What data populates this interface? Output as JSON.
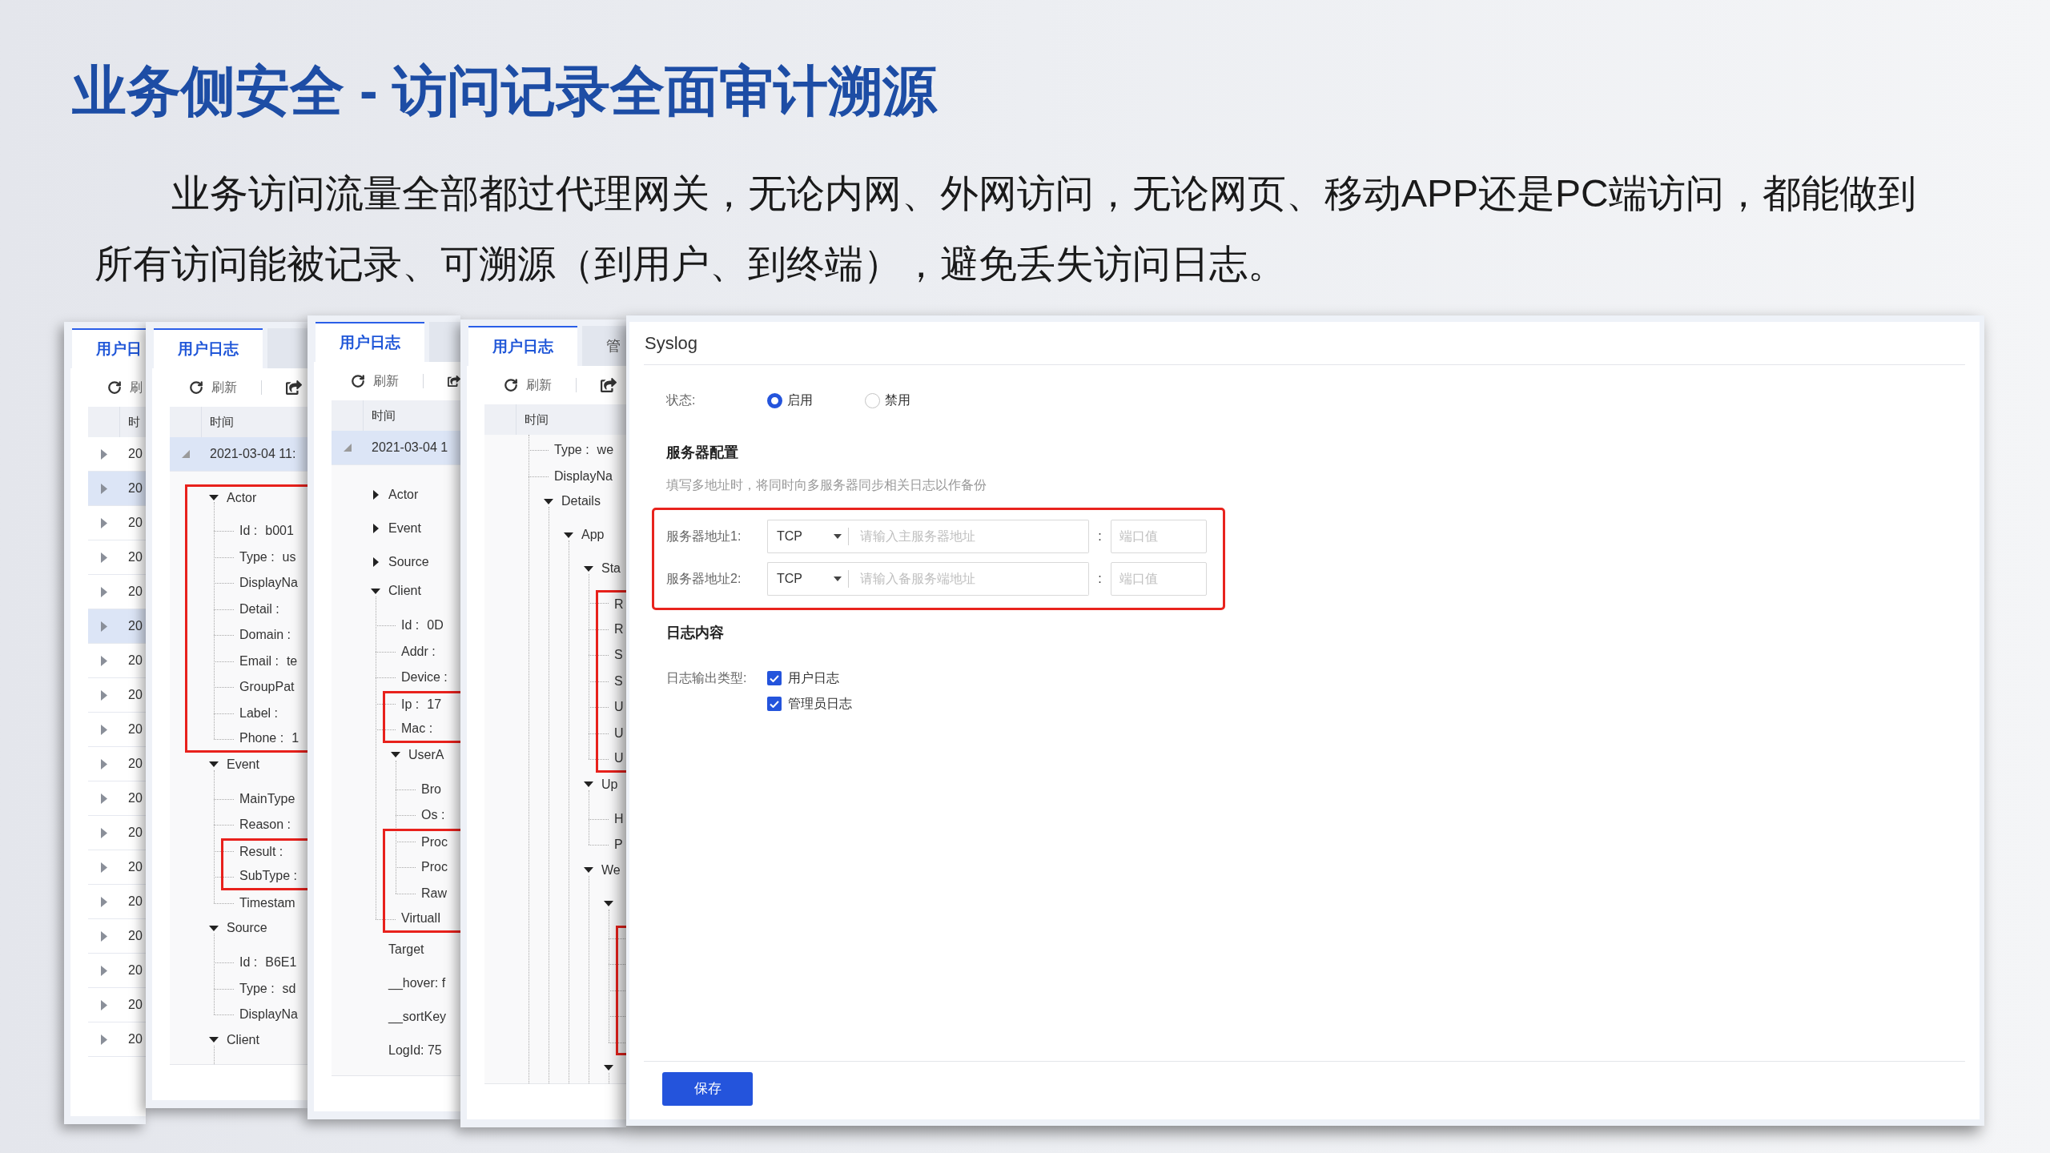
{
  "slide": {
    "title": "业务侧安全 - 访问记录全面审计溯源",
    "body": "业务访问流量全部都过代理网关，无论内网、外网访问，无论网页、移动APP还是PC端访问，都能做到所有访问能被记录、可溯源（到用户、到终端），避免丢失访问日志。"
  },
  "log_windows": [
    {
      "tabs": [
        {
          "label": "用户日",
          "selected": true
        }
      ],
      "toolbar": [
        {
          "kind": "refresh",
          "label": "刷"
        }
      ],
      "columns": [
        "时"
      ],
      "rows": [
        {
          "time": "20",
          "selected": false,
          "expanded": false
        },
        {
          "time": "20",
          "selected": true,
          "expanded": false
        },
        {
          "time": "20",
          "selected": false,
          "expanded": false
        },
        {
          "time": "20",
          "selected": false,
          "expanded": false
        },
        {
          "time": "20",
          "selected": false,
          "expanded": false
        },
        {
          "time": "20",
          "selected": true,
          "expanded": false
        },
        {
          "time": "20",
          "selected": false,
          "expanded": false
        },
        {
          "time": "20",
          "selected": false,
          "expanded": false
        },
        {
          "time": "20",
          "selected": false,
          "expanded": false
        },
        {
          "time": "20",
          "selected": false,
          "expanded": false
        },
        {
          "time": "20",
          "selected": false,
          "expanded": false
        },
        {
          "time": "20",
          "selected": false,
          "expanded": false
        },
        {
          "time": "20",
          "selected": false,
          "expanded": false
        },
        {
          "time": "20",
          "selected": false,
          "expanded": false
        },
        {
          "time": "20",
          "selected": false,
          "expanded": false
        },
        {
          "time": "20",
          "selected": false,
          "expanded": false
        },
        {
          "time": "20",
          "selected": false,
          "expanded": false
        },
        {
          "time": "20",
          "selected": false,
          "expanded": false
        }
      ]
    },
    {
      "tabs": [
        {
          "label": "用户日志",
          "selected": true
        },
        {
          "selected": false
        }
      ],
      "toolbar": [
        {
          "kind": "refresh",
          "label": "刷新"
        },
        {
          "kind": "export"
        }
      ],
      "columns": [
        "时间"
      ],
      "rows": [
        {
          "time": "2021-03-04 11:",
          "selected": true,
          "expanded": true
        }
      ],
      "detail_tree": {
        "scrolled": false,
        "nodes": [
          {
            "kind": "group",
            "label": "Actor",
            "expanded": true,
            "highlighted": true,
            "children": [
              {
                "kind": "field",
                "label": "Id :",
                "value": "b001",
                "highlighted": true
              },
              {
                "kind": "field",
                "label": "Type :",
                "value": "us",
                "highlighted": true
              },
              {
                "kind": "field",
                "label": "DisplayNa",
                "highlighted": true
              },
              {
                "kind": "field",
                "label": "Detail :",
                "highlighted": true
              },
              {
                "kind": "field",
                "label": "Domain :",
                "highlighted": true
              },
              {
                "kind": "field",
                "label": "Email :",
                "value": "te",
                "highlighted": true
              },
              {
                "kind": "field",
                "label": "GroupPat",
                "highlighted": true
              },
              {
                "kind": "field",
                "label": "Label :",
                "highlighted": true
              },
              {
                "kind": "field",
                "label": "Phone :",
                "value": "1",
                "highlighted": true
              }
            ]
          },
          {
            "kind": "group",
            "label": "Event",
            "expanded": true,
            "highlighted": false,
            "children": [
              {
                "kind": "field",
                "label": "MainType",
                "highlighted": false
              },
              {
                "kind": "field",
                "label": "Reason :",
                "highlighted": false
              },
              {
                "kind": "field",
                "label": "Result :",
                "highlighted": true
              },
              {
                "kind": "field",
                "label": "SubType :",
                "highlighted": true
              },
              {
                "kind": "field",
                "label": "Timestam",
                "highlighted": false
              }
            ]
          },
          {
            "kind": "group",
            "label": "Source",
            "expanded": true,
            "highlighted": false,
            "children": [
              {
                "kind": "field",
                "label": "Id :",
                "value": "B6E1",
                "highlighted": false
              },
              {
                "kind": "field",
                "label": "Type :",
                "value": "sd",
                "highlighted": false
              },
              {
                "kind": "field",
                "label": "DisplayNa",
                "highlighted": false
              }
            ]
          },
          {
            "kind": "group",
            "label": "Client",
            "expanded": true,
            "highlighted": false
          }
        ]
      }
    },
    {
      "tabs": [
        {
          "label": "用户日志",
          "selected": true
        },
        {
          "selected": false
        }
      ],
      "toolbar": [
        {
          "kind": "refresh",
          "label": "刷新"
        },
        {
          "kind": "export"
        }
      ],
      "columns": [
        "时间"
      ],
      "rows": [
        {
          "time": "2021-03-04 1",
          "selected": true,
          "expanded": true
        }
      ],
      "detail_tree": {
        "scrolled": false,
        "nodes": [
          {
            "kind": "group",
            "label": "Actor",
            "expanded": false,
            "highlighted": false
          },
          {
            "kind": "group",
            "label": "Event",
            "expanded": false,
            "highlighted": false
          },
          {
            "kind": "group",
            "label": "Source",
            "expanded": false,
            "highlighted": false
          },
          {
            "kind": "group",
            "label": "Client",
            "expanded": true,
            "highlighted": false,
            "children": [
              {
                "kind": "field",
                "label": "Id :",
                "value": "0D",
                "highlighted": false
              },
              {
                "kind": "field",
                "label": "Addr :",
                "highlighted": false
              },
              {
                "kind": "field",
                "label": "Device :",
                "highlighted": false
              },
              {
                "kind": "field",
                "label": "Ip :",
                "value": "17",
                "highlighted": true
              },
              {
                "kind": "field",
                "label": "Mac :",
                "highlighted": true
              },
              {
                "kind": "group",
                "label": "UserA",
                "expanded": true,
                "highlighted": false,
                "children": [
                  {
                    "kind": "field",
                    "label": "Bro",
                    "highlighted": false
                  },
                  {
                    "kind": "field",
                    "label": "Os :",
                    "highlighted": false
                  },
                  {
                    "kind": "field",
                    "label": "Proc",
                    "highlighted": true
                  },
                  {
                    "kind": "field",
                    "label": "Proc",
                    "highlighted": true
                  },
                  {
                    "kind": "field",
                    "label": "Raw",
                    "highlighted": true
                  }
                ]
              },
              {
                "kind": "field",
                "label": "VirtualI",
                "highlighted": true
              }
            ]
          },
          {
            "kind": "field",
            "label": "Target",
            "highlighted": false
          },
          {
            "kind": "field",
            "label": "__hover: f",
            "highlighted": false
          },
          {
            "kind": "field",
            "label": "__sortKey",
            "highlighted": false
          },
          {
            "kind": "field",
            "label": "LogId: 75",
            "highlighted": false
          }
        ]
      }
    },
    {
      "tabs": [
        {
          "label": "用户日志",
          "selected": true
        },
        {
          "label": "管",
          "selected": false
        }
      ],
      "toolbar": [
        {
          "kind": "refresh",
          "label": "刷新"
        },
        {
          "kind": "export"
        }
      ],
      "columns": [
        "时间"
      ],
      "detail_tree": {
        "scrolled": true,
        "nodes": [
          {
            "kind": "field",
            "label": "Type :",
            "value": "we",
            "highlighted": false
          },
          {
            "kind": "field",
            "label": "DisplayNa",
            "highlighted": false
          },
          {
            "kind": "group",
            "label": "Details",
            "expanded": true,
            "highlighted": false,
            "children": [
              {
                "kind": "group",
                "label": "App",
                "expanded": true,
                "highlighted": false,
                "children": [
                  {
                    "kind": "group",
                    "label": "Sta",
                    "expanded": true,
                    "highlighted": false,
                    "children": [
                      {
                        "kind": "field",
                        "label": "R",
                        "highlighted": true
                      },
                      {
                        "kind": "field",
                        "label": "R",
                        "highlighted": true
                      },
                      {
                        "kind": "field",
                        "label": "S",
                        "highlighted": true
                      },
                      {
                        "kind": "field",
                        "label": "S",
                        "highlighted": true
                      },
                      {
                        "kind": "field",
                        "label": "U",
                        "highlighted": true
                      },
                      {
                        "kind": "field",
                        "label": "U",
                        "highlighted": true
                      },
                      {
                        "kind": "field",
                        "label": "U",
                        "highlighted": true
                      }
                    ]
                  },
                  {
                    "kind": "group",
                    "label": "Up",
                    "expanded": true,
                    "highlighted": false,
                    "children": [
                      {
                        "kind": "field",
                        "label": "H",
                        "highlighted": false
                      },
                      {
                        "kind": "field",
                        "label": "P",
                        "highlighted": false
                      }
                    ]
                  },
                  {
                    "kind": "group",
                    "label": "We",
                    "expanded": true,
                    "highlighted": false,
                    "children": [
                      {
                        "kind": "group",
                        "expanded": true,
                        "highlighted": false,
                        "children": [
                          {
                            "kind": "field",
                            "highlighted": true
                          },
                          {
                            "kind": "field",
                            "highlighted": true
                          },
                          {
                            "kind": "field",
                            "highlighted": true
                          },
                          {
                            "kind": "field",
                            "highlighted": true
                          },
                          {
                            "kind": "field",
                            "highlighted": true
                          }
                        ]
                      },
                      {
                        "kind": "group",
                        "expanded": true,
                        "highlighted": false
                      }
                    ]
                  }
                ]
              }
            ]
          }
        ]
      }
    }
  ],
  "syslog": {
    "title": "Syslog",
    "status": {
      "label": "状态:",
      "options": [
        {
          "label": "启用",
          "selected": true
        },
        {
          "label": "禁用",
          "selected": false
        }
      ]
    },
    "server_section": {
      "heading": "服务器配置",
      "hint": "填写多地址时，将同时向多服务器同步相关日志以作备份",
      "highlighted": true,
      "servers": [
        {
          "label": "服务器地址1:",
          "protocol": "TCP",
          "address": {
            "placeholder": "请输入主服务器地址"
          },
          "separator": ":",
          "port": {
            "placeholder": "端口值"
          }
        },
        {
          "label": "服务器地址2:",
          "protocol": "TCP",
          "address": {
            "placeholder": "请输入备服务端地址"
          },
          "separator": ":",
          "port": {
            "placeholder": "端口值"
          }
        }
      ]
    },
    "log_section": {
      "heading": "日志内容",
      "label": "日志输出类型:",
      "options": [
        {
          "label": "用户日志",
          "checked": true
        },
        {
          "label": "管理员日志",
          "checked": true
        }
      ]
    },
    "save_button": "保存"
  }
}
